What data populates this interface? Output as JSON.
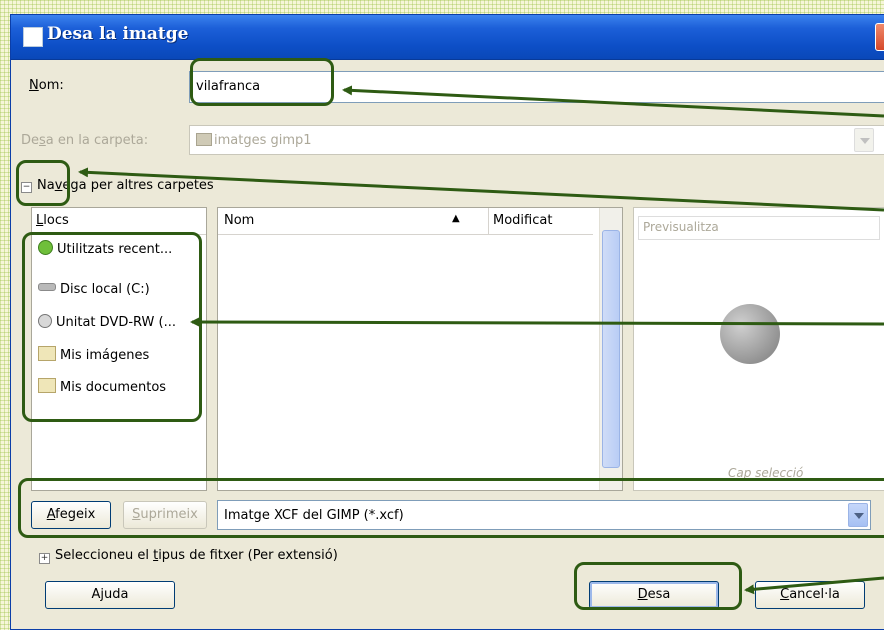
{
  "dialog": {
    "title": "Desa la imatge",
    "close_glyph": "✕"
  },
  "name_field": {
    "label_prefix": "N",
    "label_rest": "om:",
    "value": "vilafranca"
  },
  "folder": {
    "label_pre": "De",
    "label_u": "s",
    "label_post": "a en la carpeta:",
    "value": "imatges gimp1"
  },
  "browse": {
    "expander": "⊟",
    "label_pre": "Na",
    "label_u": "v",
    "label_post": "ega per altres carpetes"
  },
  "places": {
    "header_u": "L",
    "header_rest": "locs",
    "items": [
      {
        "label": "Utilitzats recent...",
        "icon": "recent-icon"
      },
      {
        "label": "Disc local (C:)",
        "icon": "harddisk-icon"
      },
      {
        "label": "Unitat DVD-RW (...",
        "icon": "dvd-drive-icon"
      },
      {
        "label": "Mis imágenes",
        "icon": "folder-icon"
      },
      {
        "label": "Mis documentos",
        "icon": "folder-icon"
      }
    ]
  },
  "files": {
    "col_name": "Nom",
    "sort_glyph": "▲",
    "col_modified": "Modificat"
  },
  "preview": {
    "header": "Previsualitza",
    "caption": "Cap selecció"
  },
  "toolbar": {
    "add_u": "A",
    "add_rest": "fegeix",
    "remove_u": "S",
    "remove_rest": "uprimeix",
    "filter_value": "Imatge XCF del GIMP (*.xcf)"
  },
  "filetype": {
    "expander": "⊞",
    "label_pre": "Seleccioneu el ",
    "label_u": "t",
    "label_post": "ipus de fitxer (Per extensió)"
  },
  "buttons": {
    "help": "Ajuda",
    "save_u": "D",
    "save_rest": "esa",
    "cancel_u": "C",
    "cancel_rest": "ancel·la"
  },
  "colors": {
    "highlight": "#2e5b13",
    "titlebar": "#0d4fc7"
  }
}
